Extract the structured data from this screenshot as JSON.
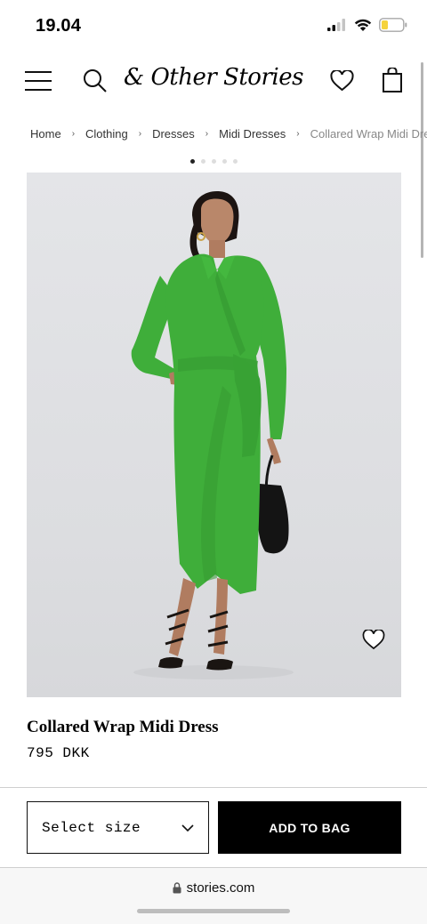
{
  "status_bar": {
    "time": "19.04"
  },
  "header": {
    "logo": "& Other Stories",
    "menu_icon": "hamburger-menu-icon",
    "search_icon": "search-icon",
    "wishlist_icon": "heart-icon",
    "bag_icon": "shopping-bag-icon"
  },
  "breadcrumb": [
    "Home",
    "Clothing",
    "Dresses",
    "Midi Dresses",
    "Collared Wrap Midi Dress"
  ],
  "gallery": {
    "image_count": 5,
    "active_index": 0
  },
  "product": {
    "name": "Collared Wrap Midi Dress",
    "price": "795 DKK",
    "image_colors": {
      "dress": "#3fae3a",
      "background": "#e0e1e4"
    }
  },
  "actions": {
    "size_select": "Select size",
    "add_to_bag": "ADD TO BAG"
  },
  "browser": {
    "url": "stories.com"
  },
  "colors": {
    "accent": "#000000",
    "text": "#111111",
    "muted": "#888888"
  }
}
